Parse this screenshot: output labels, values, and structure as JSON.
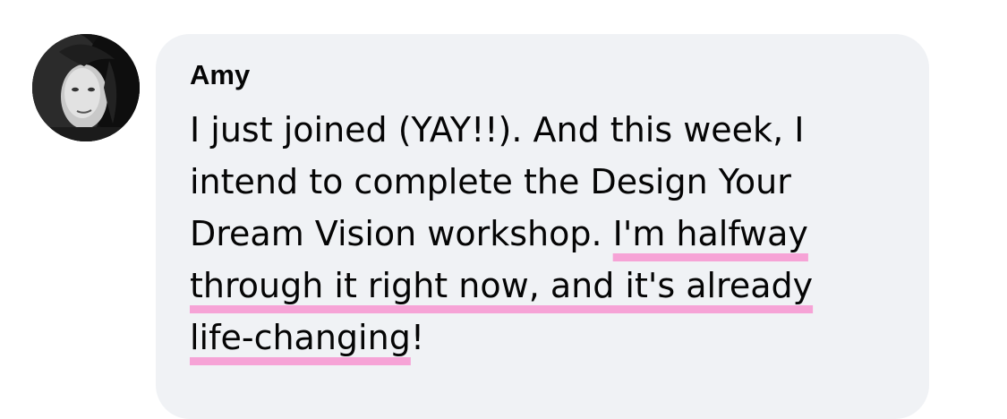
{
  "comment": {
    "author": "Amy",
    "lines": [
      {
        "plain": "I just joined (YAY!!). And this week, I",
        "highlighted": ""
      },
      {
        "plain": "intend to complete the Design Your",
        "highlighted": ""
      },
      {
        "plain": "Dream Vision workshop. ",
        "highlighted": "I'm halfway"
      },
      {
        "plain": "",
        "highlighted": "through it right now, and it's already"
      },
      {
        "plain": "",
        "highlighted": "life-changing",
        "trailing": "!"
      }
    ]
  },
  "colors": {
    "bubble_background": "#f0f2f5",
    "text": "#050505",
    "highlight_underline": "#f6a3d6"
  },
  "icons": {
    "avatar": "profile-photo"
  }
}
